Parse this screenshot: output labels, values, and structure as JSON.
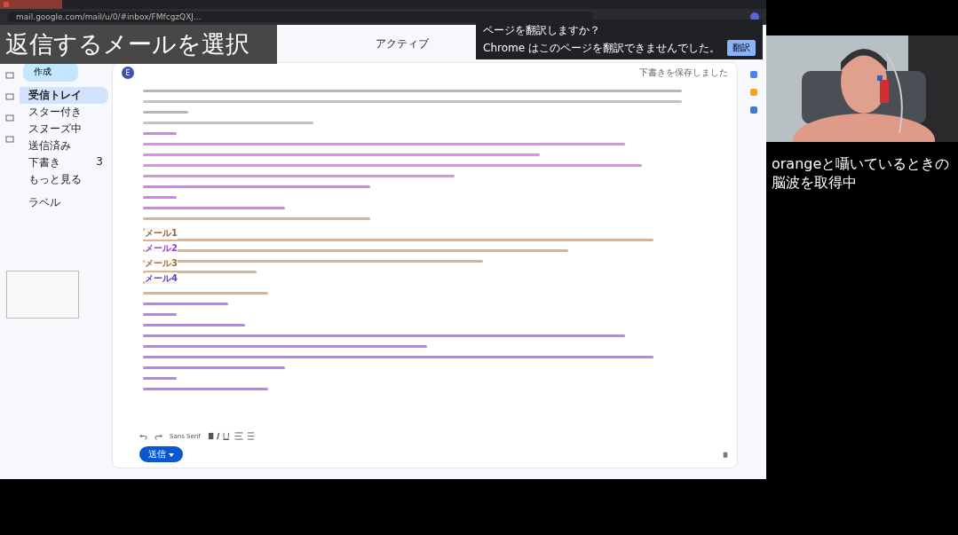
{
  "browser": {
    "url": "mail.google.com/mail/u/0/#inbox/FMfcgzQXJ..."
  },
  "overlay_caption": "返信するメールを選択",
  "gmail": {
    "compose": "作成",
    "nav": [
      {
        "label": "受信トレイ",
        "selected": true
      },
      {
        "label": "スター付き",
        "selected": false
      },
      {
        "label": "スヌーズ中",
        "selected": false
      },
      {
        "label": "送信済み",
        "selected": false
      },
      {
        "label": "下書き",
        "count": "3",
        "selected": false
      },
      {
        "label": "もっと見る",
        "selected": false
      }
    ],
    "labels_heading": "ラベル",
    "status": "アクティブ",
    "sender_initial": "E",
    "saved_note": "下書きを保存しました",
    "font": "Sans Serif",
    "send": "送信"
  },
  "mail_markers": [
    {
      "label": "メール1",
      "color": "#8a6a3a"
    },
    {
      "label": "メール2",
      "color": "#9b3fd0"
    },
    {
      "label": "メール3",
      "color": "#a0703a"
    },
    {
      "label": "メール4",
      "color": "#5a3fc0"
    }
  ],
  "translate_popup": {
    "title": "ページを翻訳しますか？",
    "message": "Chrome はこのページを翻訳できませんでした。",
    "button": "翻訳"
  },
  "camera_caption": [
    "orangeと囁いているときの",
    "脳波を取得中"
  ]
}
